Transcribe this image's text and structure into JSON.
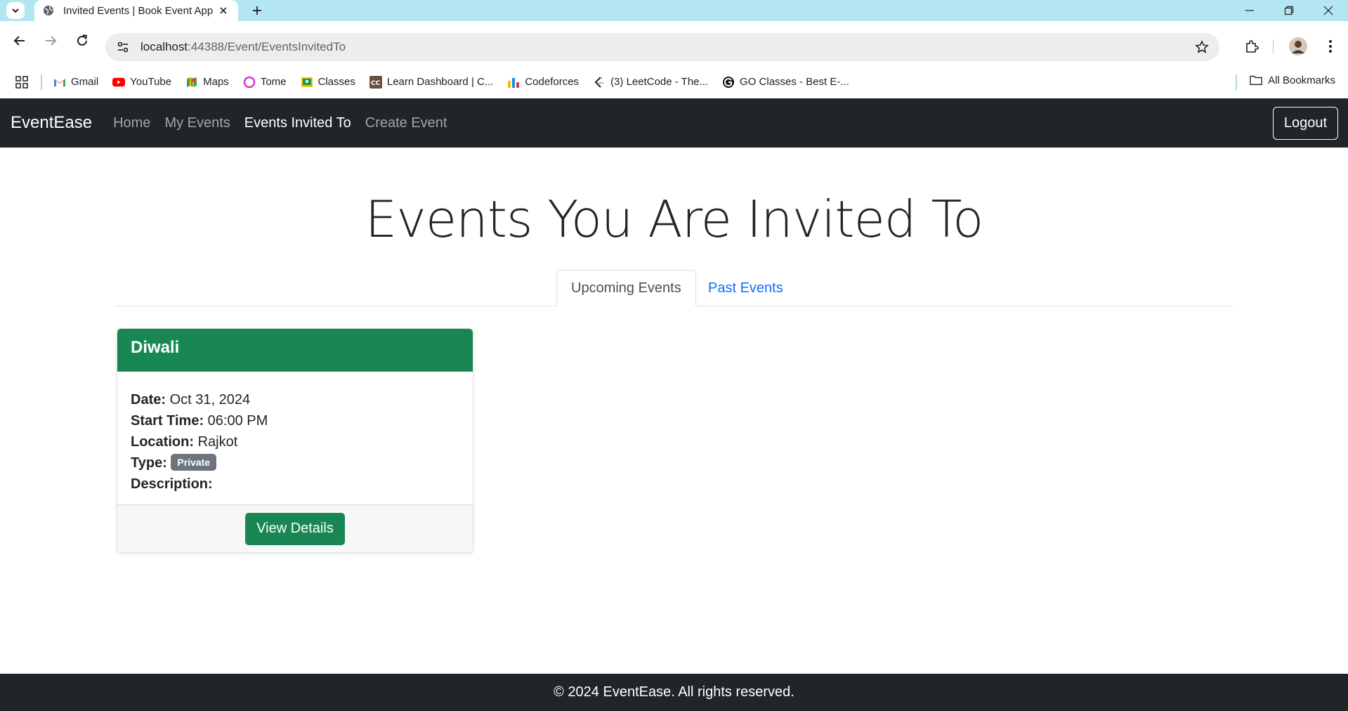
{
  "browser": {
    "tab_title": "Invited Events | Book Event App",
    "url_host": "localhost",
    "url_rest": ":44388/Event/EventsInvitedTo",
    "bookmarks": [
      {
        "label": "Gmail",
        "icon": "gmail-icon"
      },
      {
        "label": "YouTube",
        "icon": "youtube-icon"
      },
      {
        "label": "Maps",
        "icon": "maps-icon"
      },
      {
        "label": "Tome",
        "icon": "tome-icon"
      },
      {
        "label": "Classes",
        "icon": "classes-icon"
      },
      {
        "label": "Learn Dashboard | C...",
        "icon": "learn-dashboard-icon"
      },
      {
        "label": "Codeforces",
        "icon": "codeforces-icon"
      },
      {
        "label": "(3) LeetCode - The...",
        "icon": "leetcode-icon"
      },
      {
        "label": "GO Classes - Best E-...",
        "icon": "goclasses-icon"
      }
    ],
    "all_bookmarks": "All Bookmarks"
  },
  "navbar": {
    "brand": "EventEase",
    "links": [
      "Home",
      "My Events",
      "Events Invited To",
      "Create Event"
    ],
    "active": "Events Invited To",
    "logout": "Logout"
  },
  "main": {
    "title": "Events You Are Invited To",
    "tabs": [
      "Upcoming Events",
      "Past Events"
    ],
    "active_tab": "Upcoming Events",
    "event": {
      "name": "Diwali",
      "date_label": "Date:",
      "date": "Oct 31, 2024",
      "start_label": "Start Time:",
      "start": "06:00 PM",
      "location_label": "Location:",
      "location": "Rajkot",
      "type_label": "Type:",
      "type": "Private",
      "description_label": "Description:",
      "button": "View Details"
    }
  },
  "footer": {
    "text": "© 2024 EventEase. All rights reserved."
  },
  "colors": {
    "tabstrip": "#b3e5f2",
    "navbar": "#212529",
    "success": "#198754",
    "link": "#0d6efd",
    "badge": "#6c757d"
  }
}
